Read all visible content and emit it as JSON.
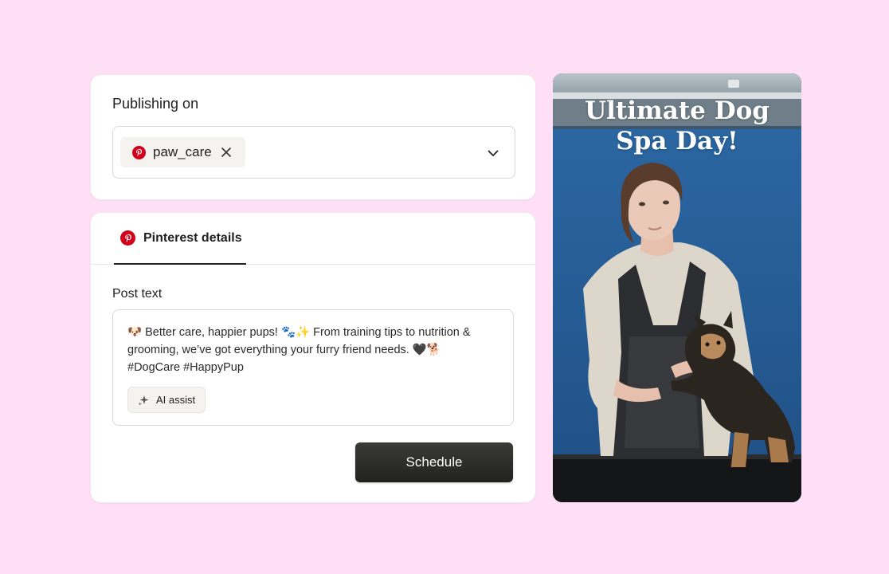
{
  "publishing": {
    "title": "Publishing on",
    "selected_account": {
      "name": "paw_care",
      "platform_icon": "pinterest-icon"
    }
  },
  "details": {
    "tab_label": "Pinterest details",
    "post_text_label": "Post text",
    "post_text": "🐶 Better care, happier pups! 🐾✨ From training tips to nutrition &\ngrooming, we’ve got everything your furry friend needs. 🖤🐕\n#DogCare #HappyPup",
    "ai_assist_label": "AI assist",
    "schedule_label": "Schedule"
  },
  "preview": {
    "title_line1": "Ultimate Dog",
    "title_line2": "Spa Day!"
  },
  "colors": {
    "background": "#ffdff5",
    "pinterest_red": "#d0021b",
    "button_dark": "#262624"
  }
}
